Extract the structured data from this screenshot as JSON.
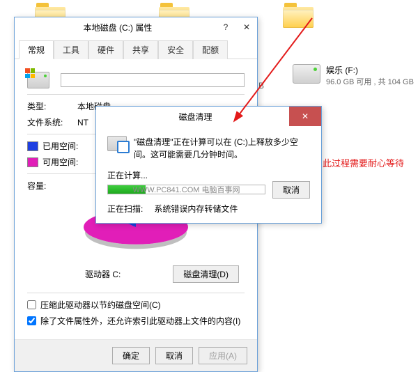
{
  "bg": {
    "drive2": {
      "name": "娱乐 (F:)",
      "size": "96.0 GB 可用 , 共 104 GB"
    },
    "stray": "B"
  },
  "properties": {
    "title": "本地磁盘 (C:) 属性",
    "tabs": [
      "常规",
      "工具",
      "硬件",
      "共享",
      "安全",
      "配额"
    ],
    "name_value": "",
    "type_label": "类型:",
    "type_value": "本地磁盘",
    "fs_label": "文件系统:",
    "fs_value": "NT",
    "used_label": "已用空间:",
    "free_label": "可用空间:",
    "capacity_label": "容量:",
    "drive_caption": "驱动器 C:",
    "cleanup_btn": "磁盘清理(D)",
    "compress_chk": "压缩此驱动器以节约磁盘空间(C)",
    "index_chk": "除了文件属性外，还允许索引此驱动器上文件的内容(I)",
    "ok": "确定",
    "cancel": "取消",
    "apply": "应用(A)"
  },
  "cleanup": {
    "title": "磁盘清理",
    "msg": "\"磁盘清理\"正在计算可以在 (C:)上释放多少空间。这可能需要几分钟时间。",
    "calculating": "正在计算...",
    "watermark": "WWW.PC841.COM 电脑百事网",
    "cancel": "取消",
    "scanning_label": "正在扫描:",
    "scanning_value": "系统错误内存转储文件"
  },
  "annotation": "此过程需要耐心等待",
  "colors": {
    "used": "#1e3fe1",
    "free": "#e11eb8"
  },
  "chart_data": {
    "type": "pie",
    "title": "驱动器 C:",
    "series": [
      {
        "name": "已用空间",
        "value_fraction": 0.14,
        "color": "#1e3fe1"
      },
      {
        "name": "可用空间",
        "value_fraction": 0.86,
        "color": "#e11eb8"
      }
    ]
  }
}
